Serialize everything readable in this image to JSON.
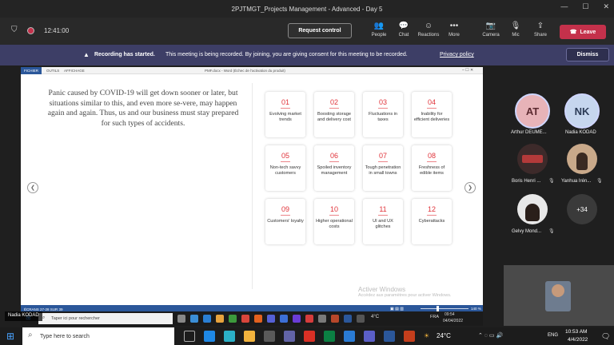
{
  "window": {
    "title": "2PJTMGT_Projects Management - Advanced - Day 5"
  },
  "toolbar": {
    "timer": "12:41:00",
    "request_control": "Request control",
    "people": "People",
    "chat": "Chat",
    "reactions": "Reactions",
    "more": "More",
    "camera": "Camera",
    "mic": "Mic",
    "share": "Share",
    "leave": "Leave"
  },
  "banner": {
    "title": "Recording has started.",
    "message": "This meeting is being recorded. By joining, you are giving consent for this meeting to be recorded.",
    "link": "Privacy policy",
    "dismiss": "Dismiss"
  },
  "word": {
    "tabs": [
      "FICHIER",
      "OUTILS",
      "AFFICHAGE"
    ],
    "doc_title": "PMF.docx - Word (Échec de l'activation du produit)",
    "status_left": "ÉCRANS 27-28 SUR 39",
    "zoom": "140 %"
  },
  "slide": {
    "text": "Panic caused by COVID-19 will get down sooner or later, but situations similar to this, and even more se-vere, may happen again and again. Thus, us and our business must stay prepared for such types of accidents.",
    "cards": [
      {
        "num": "01",
        "label": "Evolving market trends"
      },
      {
        "num": "02",
        "label": "Boosting storage and delivery cost"
      },
      {
        "num": "03",
        "label": "Fluctuations in taxes"
      },
      {
        "num": "04",
        "label": "Inability for efficient deliveries"
      },
      {
        "num": "05",
        "label": "Non-tech savvy customers"
      },
      {
        "num": "06",
        "label": "Spoiled inventory management"
      },
      {
        "num": "07",
        "label": "Tough penetration in small towns"
      },
      {
        "num": "08",
        "label": "Freshness of edible items"
      },
      {
        "num": "09",
        "label": "Customers' loyalty"
      },
      {
        "num": "10",
        "label": "Higher operational costs"
      },
      {
        "num": "11",
        "label": "UI and UX glitches"
      },
      {
        "num": "12",
        "label": "Cyberattacks"
      }
    ]
  },
  "activate": {
    "title": "Activer Windows",
    "subtitle": "Accédez aux paramètres pour activer Windows."
  },
  "participants": [
    {
      "initials": "AT",
      "name": "Arthur DEUME...",
      "color": "#e7b3b8"
    },
    {
      "initials": "NK",
      "name": "Nadia KODAD",
      "color": "#c6d6ee"
    },
    {
      "name": "Boris Henri ..."
    },
    {
      "name": "Yanhua Irén..."
    },
    {
      "name": "Gelvy Mond..."
    }
  ],
  "more_participants": "+34",
  "presenter_tag": "Nadia KODAD",
  "inner_taskbar": {
    "search": "Taper ici pour rechercher",
    "temp": "4°C",
    "lang": "FRA",
    "time": "09:54",
    "date": "04/04/2022"
  },
  "taskbar": {
    "search": "Type here to search",
    "temp": "24°C",
    "lang": "ENG",
    "time": "10:53 AM",
    "date": "4/4/2022"
  }
}
